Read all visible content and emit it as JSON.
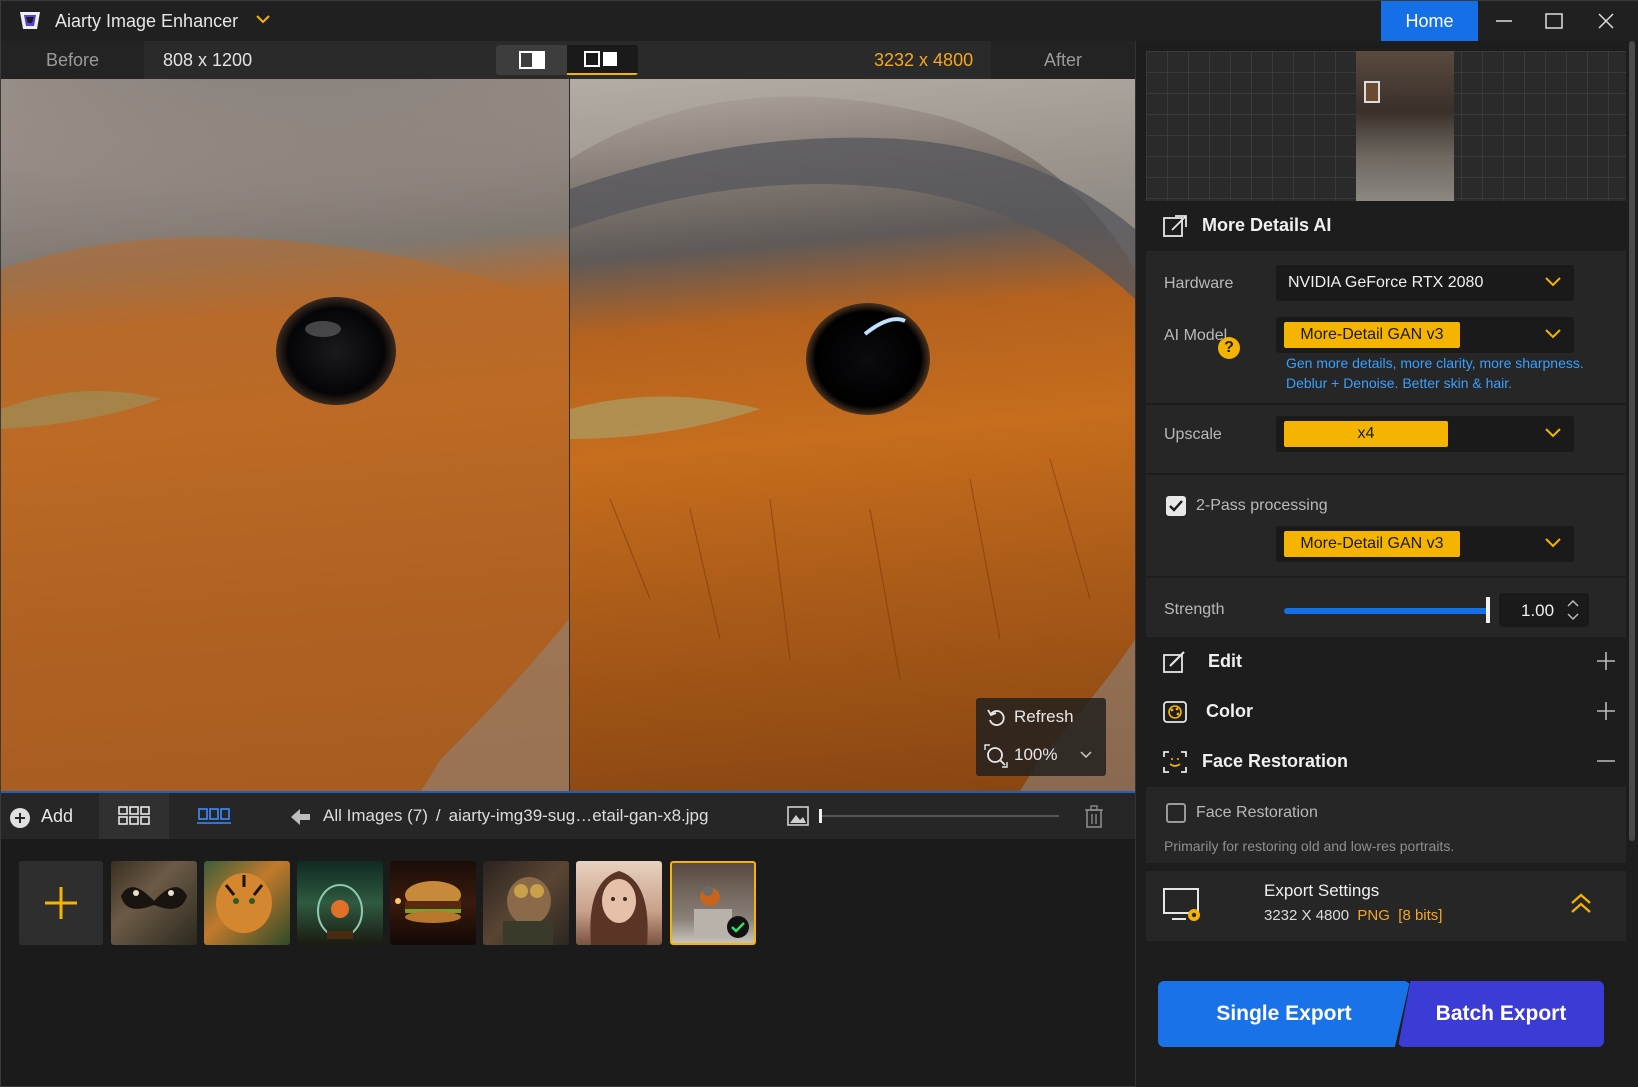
{
  "titlebar": {
    "app_title": "Aiarty Image Enhancer",
    "home_label": "Home"
  },
  "compare": {
    "before_label": "Before",
    "before_size": "808 x 1200",
    "after_size": "3232 x 4800",
    "after_label": "After"
  },
  "overlay": {
    "refresh_label": "Refresh",
    "zoom_label": "100%"
  },
  "filmstrip": {
    "add_label": "Add",
    "breadcrumb_root": "All Images (7)",
    "breadcrumb_sep": "/",
    "breadcrumb_file": "aiarty-img39-sug…etail-gan-x8.jpg",
    "thumbnails": [
      "butterfly",
      "tiger",
      "terrarium",
      "burger",
      "steampunk-dog",
      "portrait",
      "robin"
    ],
    "selected_index": 6
  },
  "panel": {
    "section_title": "More Details AI",
    "hardware_label": "Hardware",
    "hardware_value": "NVIDIA GeForce RTX 2080",
    "model_label": "AI Model",
    "model_value": "More-Detail GAN  v3",
    "model_desc_1": "Gen more details, more clarity, more sharpness.",
    "model_desc_2": "Deblur + Denoise. Better skin & hair.",
    "help_glyph": "?",
    "upscale_label": "Upscale",
    "upscale_value": "x4",
    "twopass_label": "2-Pass processing",
    "twopass_checked": true,
    "twopass_model": "More-Detail GAN  v3",
    "strength_label": "Strength",
    "strength_value": "1.00",
    "strength_fraction": 1.0,
    "edit_label": "Edit",
    "color_label": "Color",
    "face_label": "Face Restoration",
    "face_checkbox_label": "Face Restoration",
    "face_checked": false,
    "face_desc": "Primarily for restoring old and low-res portraits."
  },
  "export": {
    "settings_title": "Export Settings",
    "settings_size": "3232 X 4800",
    "settings_format": "PNG",
    "settings_bits": "[8 bits]",
    "single_label": "Single Export",
    "batch_label": "Batch Export"
  },
  "colors": {
    "accent_blue": "#1570e8",
    "accent_yellow": "#f5b400",
    "accent_orange": "#f5a623",
    "batch_purple": "#3b3bd6"
  }
}
